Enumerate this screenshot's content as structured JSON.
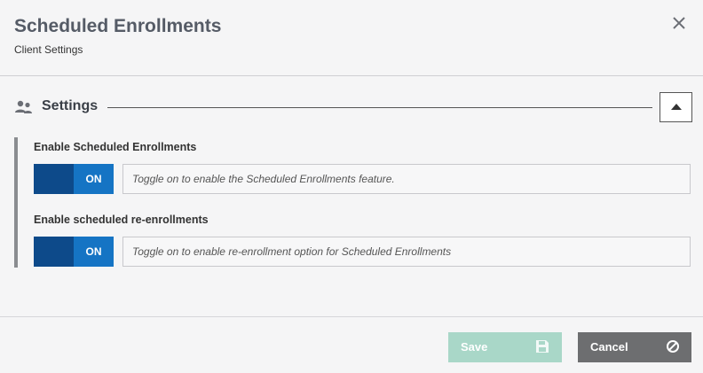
{
  "header": {
    "title": "Scheduled Enrollments",
    "subtitle": "Client Settings",
    "close_icon": "close-icon"
  },
  "section": {
    "icon": "people-icon",
    "title": "Settings",
    "collapse_icon": "caret-up-icon"
  },
  "settings": [
    {
      "label": "Enable Scheduled Enrollments",
      "toggle_state": "ON",
      "description": "Toggle on to enable the Scheduled Enrollments feature."
    },
    {
      "label": "Enable scheduled re-enrollments",
      "toggle_state": "ON",
      "description": "Toggle on to enable re-enrollment option for Scheduled Enrollments"
    }
  ],
  "footer": {
    "save_label": "Save",
    "save_icon": "floppy-disk-icon",
    "cancel_label": "Cancel",
    "cancel_icon": "ban-icon"
  },
  "colors": {
    "toggle_on": "#1574c4",
    "toggle_knob": "#0d4a8a",
    "save_button": "#a9d7c8",
    "cancel_button": "#6d6e70"
  }
}
